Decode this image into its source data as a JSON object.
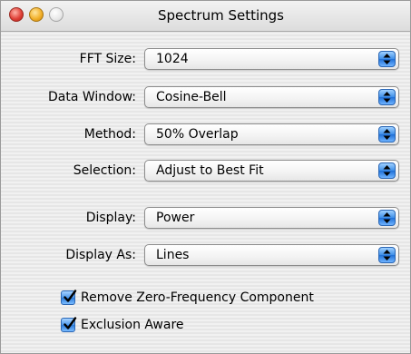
{
  "window": {
    "title": "Spectrum Settings"
  },
  "fields": [
    {
      "label": "FFT Size:",
      "value": "1024"
    },
    {
      "label": "Data Window:",
      "value": "Cosine-Bell"
    },
    {
      "label": "Method:",
      "value": "50% Overlap"
    },
    {
      "label": "Selection:",
      "value": "Adjust to Best Fit"
    },
    {
      "label": "Display:",
      "value": "Power"
    },
    {
      "label": "Display As:",
      "value": "Lines"
    }
  ],
  "checkboxes": [
    {
      "label": "Remove Zero-Frequency Component",
      "checked": true
    },
    {
      "label": "Exclusion Aware",
      "checked": true
    }
  ],
  "colors": {
    "accent": "#3d8ee8",
    "close": "#e0433a",
    "minimize": "#f2b12c",
    "zoom_disabled": "#e8e8e8"
  }
}
